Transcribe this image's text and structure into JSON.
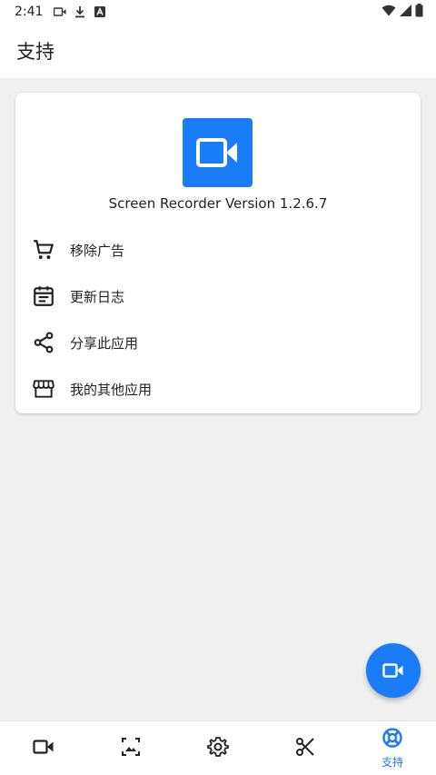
{
  "status_bar": {
    "time": "2:41"
  },
  "app_bar": {
    "title": "支持"
  },
  "card": {
    "version_text": "Screen Recorder Version 1.2.6.7",
    "items": [
      {
        "label": "移除广告",
        "icon": "cart-icon"
      },
      {
        "label": "更新日志",
        "icon": "changelog-icon"
      },
      {
        "label": "分享此应用",
        "icon": "share-icon"
      },
      {
        "label": "我的其他应用",
        "icon": "store-icon"
      }
    ]
  },
  "bottom_nav": {
    "items": [
      {
        "id": "record",
        "icon": "video-camera-icon",
        "label": ""
      },
      {
        "id": "gallery",
        "icon": "image-icon",
        "label": ""
      },
      {
        "id": "settings",
        "icon": "gear-icon",
        "label": ""
      },
      {
        "id": "edit",
        "icon": "scissors-icon",
        "label": ""
      },
      {
        "id": "support",
        "icon": "lifebuoy-icon",
        "label": "支持",
        "active": true
      }
    ]
  },
  "colors": {
    "accent": "#1a7cf7",
    "background": "#f0f0f0",
    "surface": "#ffffff",
    "text": "#212121"
  }
}
